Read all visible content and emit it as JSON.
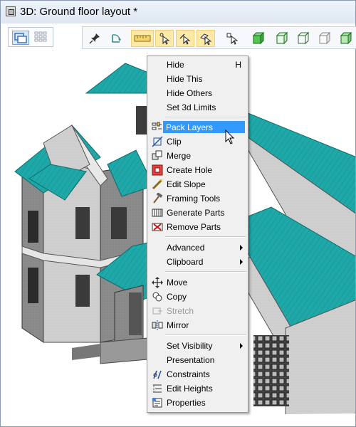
{
  "window": {
    "title": "3D: Ground floor layout *"
  },
  "toolbar": {
    "view_icons": [
      "single-view-icon",
      "tiled-view-icon"
    ],
    "tools": [
      "pin-icon",
      "rotate-frame-icon",
      "ruler-icon",
      "select-point-icon",
      "select-edge-icon",
      "select-face-icon",
      "select-object-icon",
      "box-solid-icon",
      "box-wire-icon",
      "box-outline-icon",
      "box-hidden-icon",
      "box-shaded-icon"
    ]
  },
  "colors": {
    "roof": "#1fa8a8",
    "wall": "#c8c8c8",
    "highlight": "#3399ff",
    "toolbar_highlight": "#fde9a8"
  },
  "context_menu": {
    "hide": "Hide",
    "hide_shortcut": "H",
    "hide_this": "Hide This",
    "hide_others": "Hide Others",
    "set_3d_limits": "Set 3d Limits",
    "pack_layers": "Pack Layers",
    "clip": "Clip",
    "merge": "Merge",
    "create_hole": "Create Hole",
    "edit_slope": "Edit Slope",
    "framing_tools": "Framing Tools",
    "generate_parts": "Generate Parts",
    "remove_parts": "Remove Parts",
    "advanced": "Advanced",
    "clipboard": "Clipboard",
    "move": "Move",
    "copy": "Copy",
    "stretch": "Stretch",
    "mirror": "Mirror",
    "set_visibility": "Set Visibility",
    "presentation": "Presentation",
    "constraints": "Constraints",
    "edit_heights": "Edit Heights",
    "properties": "Properties"
  }
}
